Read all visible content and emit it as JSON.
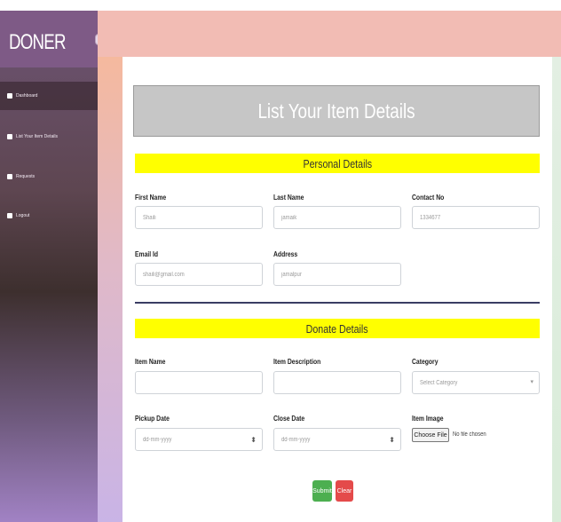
{
  "brand": "DONER",
  "sidebar": {
    "items": [
      {
        "label": "Dashboard",
        "icon": "gauge-icon"
      },
      {
        "label": "List Your Item Details",
        "icon": "list-icon"
      },
      {
        "label": "Requests",
        "icon": "inbox-icon"
      },
      {
        "label": "Logout",
        "icon": "user-icon"
      }
    ]
  },
  "form": {
    "title": "List Your Item Details",
    "personal": {
      "heading": "Personal Details",
      "first_name": {
        "label": "First Name",
        "value": "Shaili"
      },
      "last_name": {
        "label": "Last Name",
        "value": "jamaik"
      },
      "contact": {
        "label": "Contact No",
        "value": "1334677"
      },
      "email": {
        "label": "Email Id",
        "value": "shaili@gmail.com"
      },
      "address": {
        "label": "Address",
        "value": "jamalpur"
      }
    },
    "donate": {
      "heading": "Donate Details",
      "item_name": {
        "label": "Item Name",
        "value": ""
      },
      "item_description": {
        "label": "Item Description",
        "value": ""
      },
      "category": {
        "label": "Category",
        "value": "Select Category"
      },
      "pickup_date": {
        "label": "Pickup Date",
        "value": "dd-mm-yyyy"
      },
      "close_date": {
        "label": "Close Date",
        "value": "dd-mm-yyyy"
      },
      "item_image": {
        "label": "Item Image",
        "button": "Choose File",
        "status": "No file chosen"
      }
    },
    "buttons": {
      "submit": "Submit",
      "clear": "Clear"
    }
  },
  "colors": {
    "sidebar": "#6d5474",
    "topbar": "#f2bcb4",
    "hero": "#c6c6c6",
    "section_bar": "#ffff00",
    "submit": "#4caf50",
    "clear": "#e44a4a"
  }
}
